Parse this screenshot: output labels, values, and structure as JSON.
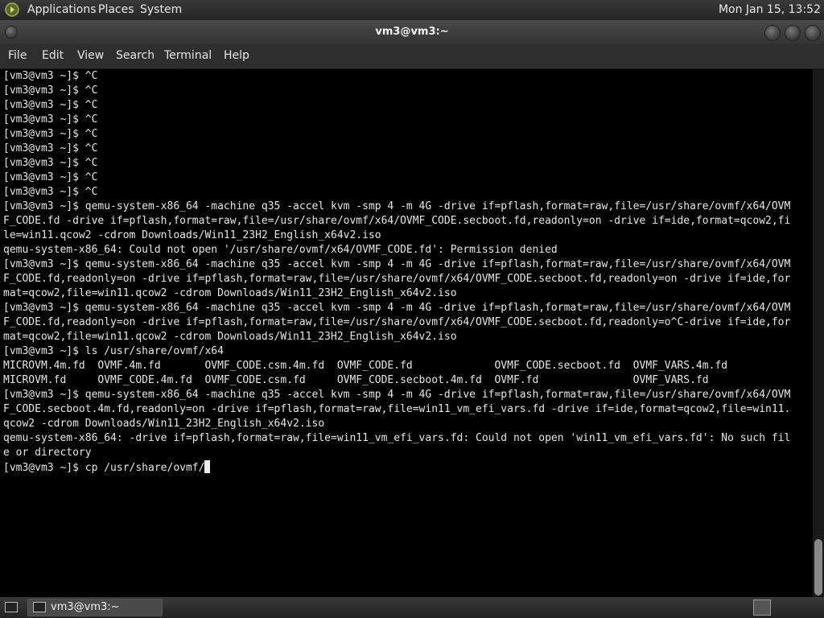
{
  "top_panel": {
    "menus": [
      "Applications",
      "Places",
      "System"
    ],
    "clock": "Mon Jan 15, 13:52"
  },
  "window": {
    "title": "vm3@vm3:~"
  },
  "menubar": {
    "items": [
      "File",
      "Edit",
      "View",
      "Search",
      "Terminal",
      "Help"
    ]
  },
  "terminal": {
    "lines": [
      "[vm3@vm3 ~]$ ^C",
      "[vm3@vm3 ~]$ ^C",
      "[vm3@vm3 ~]$ ^C",
      "[vm3@vm3 ~]$ ^C",
      "[vm3@vm3 ~]$ ^C",
      "[vm3@vm3 ~]$ ^C",
      "[vm3@vm3 ~]$ ^C",
      "[vm3@vm3 ~]$ ^C",
      "[vm3@vm3 ~]$ ^C",
      "[vm3@vm3 ~]$ qemu-system-x86_64 -machine q35 -accel kvm -smp 4 -m 4G -drive if=pflash,format=raw,file=/usr/share/ovmf/x64/OVM",
      "F_CODE.fd -drive if=pflash,format=raw,file=/usr/share/ovmf/x64/OVMF_CODE.secboot.fd,readonly=on -drive if=ide,format=qcow2,fi",
      "le=win11.qcow2 -cdrom Downloads/Win11_23H2_English_x64v2.iso",
      "qemu-system-x86_64: Could not open '/usr/share/ovmf/x64/OVMF_CODE.fd': Permission denied",
      "[vm3@vm3 ~]$ qemu-system-x86_64 -machine q35 -accel kvm -smp 4 -m 4G -drive if=pflash,format=raw,file=/usr/share/ovmf/x64/OVM",
      "F_CODE.fd,readonly=on -drive if=pflash,format=raw,file=/usr/share/ovmf/x64/OVMF_CODE.secboot.fd,readonly=on -drive if=ide,for",
      "mat=qcow2,file=win11.qcow2 -cdrom Downloads/Win11_23H2_English_x64v2.iso",
      "[vm3@vm3 ~]$ qemu-system-x86_64 -machine q35 -accel kvm -smp 4 -m 4G -drive if=pflash,format=raw,file=/usr/share/ovmf/x64/OVM",
      "F_CODE.fd,readonly=on -drive if=pflash,format=raw,file=/usr/share/ovmf/x64/OVMF_CODE.secboot.fd,readonly=o^C-drive if=ide,for",
      "mat=qcow2,file=win11.qcow2 -cdrom Downloads/Win11_23H2_English_x64v2.iso",
      "[vm3@vm3 ~]$ ls /usr/share/ovmf/x64",
      "MICROVM.4m.fd  OVMF.4m.fd       OVMF_CODE.csm.4m.fd  OVMF_CODE.fd             OVMF_CODE.secboot.fd  OVMF_VARS.4m.fd",
      "MICROVM.fd     OVMF_CODE.4m.fd  OVMF_CODE.csm.fd     OVMF_CODE.secboot.4m.fd  OVMF.fd               OVMF_VARS.fd",
      "[vm3@vm3 ~]$ qemu-system-x86_64 -machine q35 -accel kvm -smp 4 -m 4G -drive if=pflash,format=raw,file=/usr/share/ovmf/x64/OVM",
      "F_CODE.secboot.4m.fd,readonly=on -drive if=pflash,format=raw,file=win11_vm_efi_vars.fd -drive if=ide,format=qcow2,file=win11.",
      "qcow2 -cdrom Downloads/Win11_23H2_English_x64v2.iso",
      "qemu-system-x86_64: -drive if=pflash,format=raw,file=win11_vm_efi_vars.fd: Could not open 'win11_vm_efi_vars.fd': No such fil",
      "e or directory"
    ],
    "prompt_line": "[vm3@vm3 ~]$ cp /usr/share/ovmf/"
  },
  "taskbar": {
    "task_label": "vm3@vm3:~"
  }
}
